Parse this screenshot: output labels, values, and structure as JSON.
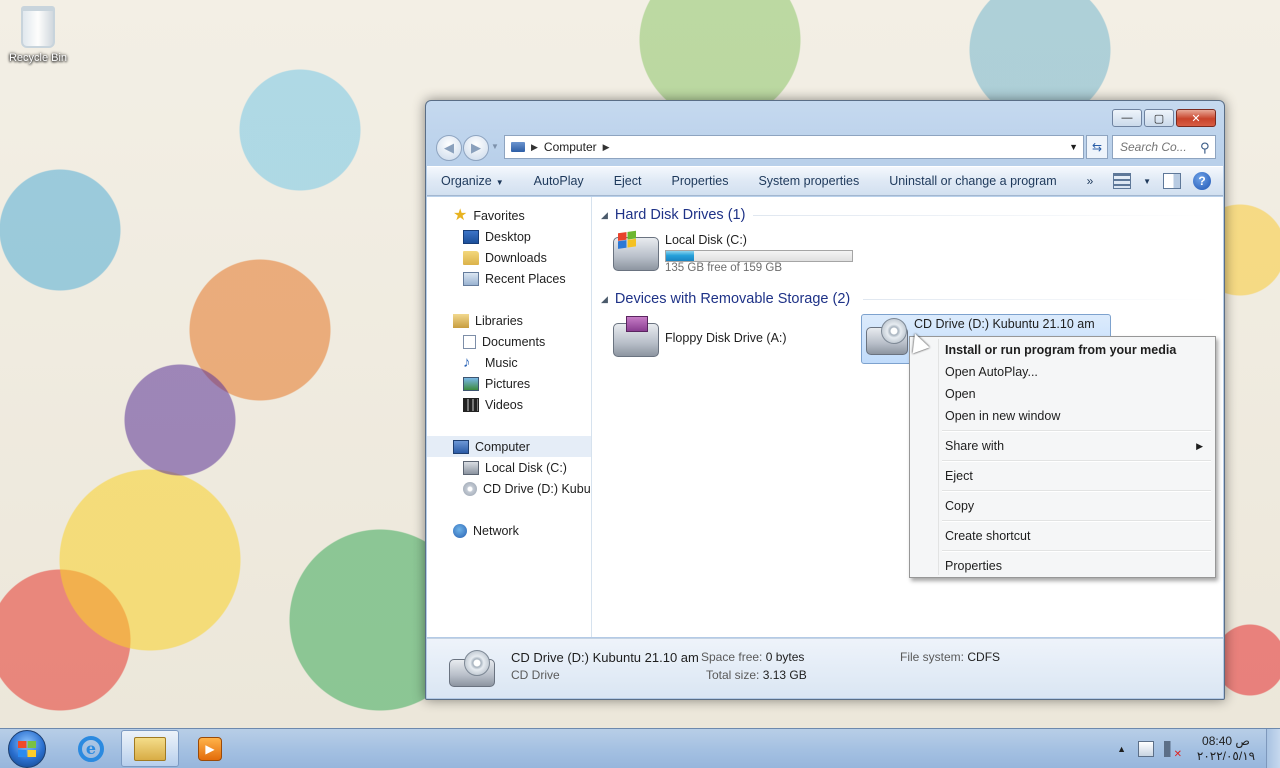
{
  "desktop": {
    "recycle_bin_label": "Recycle Bin"
  },
  "window": {
    "caption": {
      "minimize": "—",
      "maximize": "▢",
      "close": "✕"
    },
    "address": {
      "location": "Computer",
      "search_placeholder": "Search Co..."
    },
    "commands": {
      "organize": "Organize",
      "autoplay": "AutoPlay",
      "eject": "Eject",
      "properties": "Properties",
      "system_properties": "System properties",
      "uninstall": "Uninstall or change a program",
      "more": "»"
    },
    "nav_pane": {
      "favorites": "Favorites",
      "desktop": "Desktop",
      "downloads": "Downloads",
      "recent_places": "Recent Places",
      "libraries": "Libraries",
      "documents": "Documents",
      "music": "Music",
      "pictures": "Pictures",
      "videos": "Videos",
      "computer": "Computer",
      "local_disk": "Local Disk (C:)",
      "cd_drive": "CD Drive (D:) Kubun",
      "network": "Network"
    },
    "content": {
      "hard_disk_group": "Hard Disk Drives (1)",
      "removable_group": "Devices with Removable Storage (2)",
      "local_disk": {
        "name": "Local Disk (C:)",
        "free_text": "135 GB free of 159 GB",
        "used_fraction": 0.15
      },
      "floppy": {
        "name": "Floppy Disk Drive (A:)"
      },
      "cd_drive": {
        "name": "CD Drive (D:) Kubuntu 21.10 am"
      }
    },
    "details": {
      "title": "CD Drive (D:) Kubuntu 21.10 am",
      "type": "CD Drive",
      "space_free_label": "Space free:",
      "space_free_value": "0 bytes",
      "total_size_label": "Total size:",
      "total_size_value": "3.13 GB",
      "file_system_label": "File system:",
      "file_system_value": "CDFS"
    }
  },
  "context_menu": {
    "install": "Install or run program from your media",
    "open_autoplay": "Open AutoPlay...",
    "open": "Open",
    "open_new_window": "Open in new window",
    "share_with": "Share with",
    "eject": "Eject",
    "copy": "Copy",
    "create_shortcut": "Create shortcut",
    "properties": "Properties"
  },
  "taskbar": {
    "clock_time": "08:40 ص",
    "clock_date": "٢٠٢٢/٠٥/١٩"
  },
  "colors": {
    "usage_bar": "#26a0da",
    "group_header": "#1e3287",
    "window_frame": "#b9d0ea"
  }
}
